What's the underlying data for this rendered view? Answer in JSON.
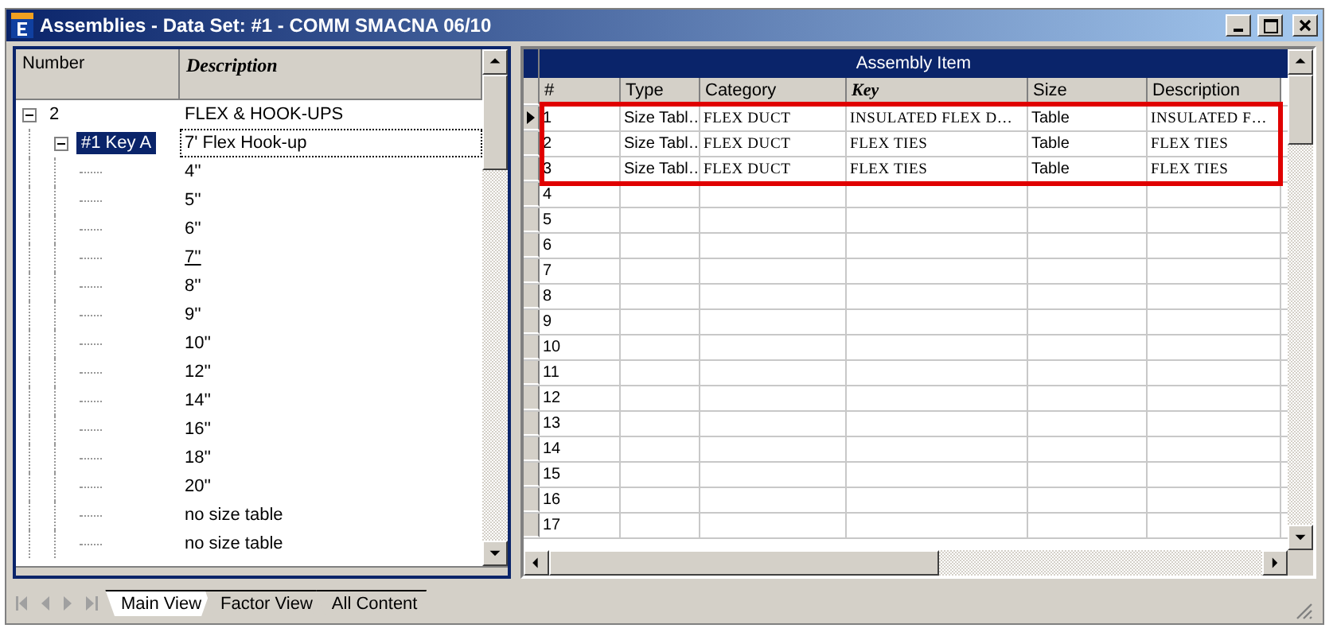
{
  "window": {
    "title": "Assemblies - Data Set: #1 - COMM SMACNA 06/10"
  },
  "tree": {
    "columns": [
      {
        "label": "Number",
        "italic": false
      },
      {
        "label": "Description",
        "italic": true
      }
    ],
    "items": [
      {
        "number": "2",
        "description": "FLEX & HOOK-UPS",
        "expanded": true,
        "selected": false,
        "children": [
          {
            "number": "#1 Key A",
            "description": "7' Flex Hook-up",
            "expanded": true,
            "selected": true,
            "children": [
              {
                "description": "4''",
                "selected": false,
                "underlined": false
              },
              {
                "description": "5''",
                "selected": false,
                "underlined": false
              },
              {
                "description": "6''",
                "selected": false,
                "underlined": false
              },
              {
                "description": "7''",
                "selected": false,
                "underlined": true
              },
              {
                "description": "8''",
                "selected": false,
                "underlined": false
              },
              {
                "description": "9''",
                "selected": false,
                "underlined": false
              },
              {
                "description": "10''",
                "selected": false,
                "underlined": false
              },
              {
                "description": "12''",
                "selected": false,
                "underlined": false
              },
              {
                "description": "14''",
                "selected": false,
                "underlined": false
              },
              {
                "description": "16''",
                "selected": false,
                "underlined": false
              },
              {
                "description": "18''",
                "selected": false,
                "underlined": false
              },
              {
                "description": "20''",
                "selected": false,
                "underlined": false
              },
              {
                "description": "no size table",
                "selected": false,
                "underlined": false
              },
              {
                "description": "no size table",
                "selected": false,
                "underlined": false
              }
            ]
          }
        ]
      }
    ]
  },
  "grid": {
    "title": "Assembly Item",
    "columns": [
      {
        "label": "#",
        "italic": false
      },
      {
        "label": "Type",
        "italic": false
      },
      {
        "label": "Category",
        "italic": false
      },
      {
        "label": "Key",
        "italic": true
      },
      {
        "label": "Size",
        "italic": false
      },
      {
        "label": "Description",
        "italic": false
      }
    ],
    "rows": [
      {
        "cells": [
          "1",
          "Size Tabl…",
          "FLEX DUCT",
          "INSULATED FLEX D…",
          "Table",
          "INSULATED F…"
        ],
        "current": true,
        "highlighted": true
      },
      {
        "cells": [
          "2",
          "Size Tabl…",
          "FLEX DUCT",
          "FLEX TIES",
          "Table",
          "FLEX TIES"
        ],
        "current": false,
        "highlighted": true
      },
      {
        "cells": [
          "3",
          "Size Tabl…",
          "FLEX DUCT",
          "FLEX TIES",
          "Table",
          "FLEX TIES"
        ],
        "current": false,
        "highlighted": true
      },
      {
        "cells": [
          "4"
        ],
        "current": false,
        "highlighted": false
      },
      {
        "cells": [
          "5"
        ],
        "current": false,
        "highlighted": false
      },
      {
        "cells": [
          "6"
        ],
        "current": false,
        "highlighted": false
      },
      {
        "cells": [
          "7"
        ],
        "current": false,
        "highlighted": false
      },
      {
        "cells": [
          "8"
        ],
        "current": false,
        "highlighted": false
      },
      {
        "cells": [
          "9"
        ],
        "current": false,
        "highlighted": false
      },
      {
        "cells": [
          "10"
        ],
        "current": false,
        "highlighted": false
      },
      {
        "cells": [
          "11"
        ],
        "current": false,
        "highlighted": false
      },
      {
        "cells": [
          "12"
        ],
        "current": false,
        "highlighted": false
      },
      {
        "cells": [
          "13"
        ],
        "current": false,
        "highlighted": false
      },
      {
        "cells": [
          "14"
        ],
        "current": false,
        "highlighted": false
      },
      {
        "cells": [
          "15"
        ],
        "current": false,
        "highlighted": false
      },
      {
        "cells": [
          "16"
        ],
        "current": false,
        "highlighted": false
      },
      {
        "cells": [
          "17"
        ],
        "current": false,
        "highlighted": false
      }
    ]
  },
  "view_tabs": [
    {
      "label": "Main View",
      "selected": true
    },
    {
      "label": "Factor View",
      "selected": false
    },
    {
      "label": "All Content",
      "selected": false
    }
  ]
}
